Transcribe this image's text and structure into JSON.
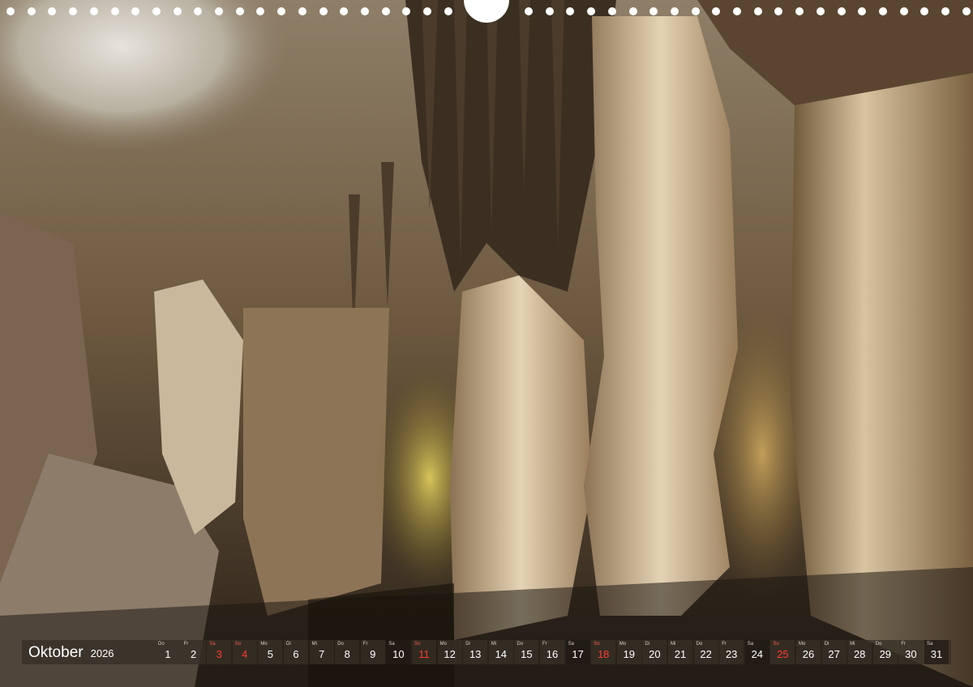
{
  "calendar": {
    "month": "Oktober",
    "year": "2026",
    "days": [
      {
        "dow": "Do",
        "num": "1",
        "type": "weekday"
      },
      {
        "dow": "Fr",
        "num": "2",
        "type": "weekday"
      },
      {
        "dow": "Sa",
        "num": "3",
        "type": "holiday"
      },
      {
        "dow": "So",
        "num": "4",
        "type": "holiday"
      },
      {
        "dow": "Mo",
        "num": "5",
        "type": "weekday"
      },
      {
        "dow": "Di",
        "num": "6",
        "type": "weekday"
      },
      {
        "dow": "Mi",
        "num": "7",
        "type": "weekday"
      },
      {
        "dow": "Do",
        "num": "8",
        "type": "weekday"
      },
      {
        "dow": "Fr",
        "num": "9",
        "type": "weekday"
      },
      {
        "dow": "Sa",
        "num": "10",
        "type": "weekend"
      },
      {
        "dow": "So",
        "num": "11",
        "type": "holiday"
      },
      {
        "dow": "Mo",
        "num": "12",
        "type": "weekday"
      },
      {
        "dow": "Di",
        "num": "13",
        "type": "weekday"
      },
      {
        "dow": "Mi",
        "num": "14",
        "type": "weekday"
      },
      {
        "dow": "Do",
        "num": "15",
        "type": "weekday"
      },
      {
        "dow": "Fr",
        "num": "16",
        "type": "weekday"
      },
      {
        "dow": "Sa",
        "num": "17",
        "type": "weekend"
      },
      {
        "dow": "So",
        "num": "18",
        "type": "holiday"
      },
      {
        "dow": "Mo",
        "num": "19",
        "type": "weekday"
      },
      {
        "dow": "Di",
        "num": "20",
        "type": "weekday"
      },
      {
        "dow": "Mi",
        "num": "21",
        "type": "weekday"
      },
      {
        "dow": "Do",
        "num": "22",
        "type": "weekday"
      },
      {
        "dow": "Fr",
        "num": "23",
        "type": "weekday"
      },
      {
        "dow": "Sa",
        "num": "24",
        "type": "weekend"
      },
      {
        "dow": "So",
        "num": "25",
        "type": "holiday"
      },
      {
        "dow": "Mo",
        "num": "26",
        "type": "weekday"
      },
      {
        "dow": "Di",
        "num": "27",
        "type": "weekday"
      },
      {
        "dow": "Mi",
        "num": "28",
        "type": "weekday"
      },
      {
        "dow": "Do",
        "num": "29",
        "type": "weekday"
      },
      {
        "dow": "Fr",
        "num": "30",
        "type": "weekday"
      },
      {
        "dow": "Sa",
        "num": "31",
        "type": "weekend"
      }
    ]
  },
  "photo": {
    "subject": "cave-stalactites-photo",
    "colors": {
      "rock_light": "#d9c9ae",
      "rock_mid": "#a58c6a",
      "rock_dark": "#3a2e22",
      "glow_yellow": "#c9b24a",
      "shadow": "#1e1812"
    }
  },
  "binding": {
    "hole_color": "#ffffff"
  }
}
